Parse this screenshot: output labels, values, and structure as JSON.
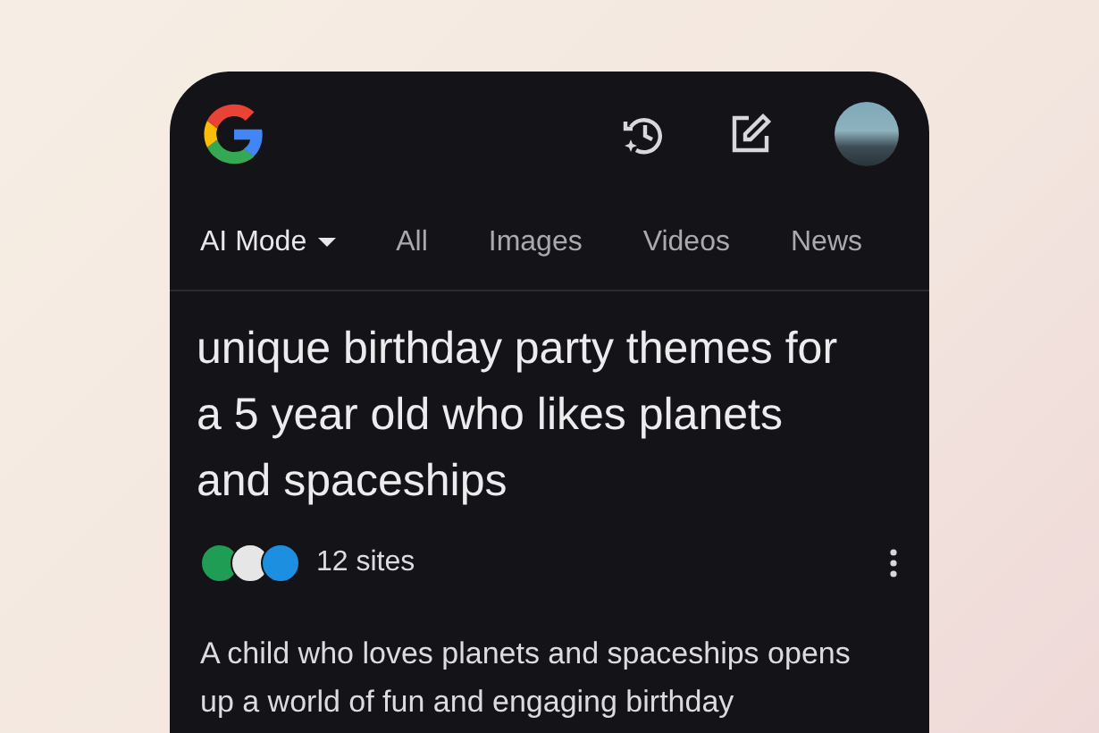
{
  "tabs": [
    {
      "label": "AI Mode",
      "selected": true,
      "dropdown": true
    },
    {
      "label": "All",
      "selected": false,
      "dropdown": false
    },
    {
      "label": "Images",
      "selected": false,
      "dropdown": false
    },
    {
      "label": "Videos",
      "selected": false,
      "dropdown": false
    },
    {
      "label": "News",
      "selected": false,
      "dropdown": false
    }
  ],
  "query": "unique birthday party themes for a 5 year old who likes planets and spaceships",
  "sources": {
    "favicons": [
      {
        "color": "#1f9d55"
      },
      {
        "color": "#e6e6e6"
      },
      {
        "color": "#1d8fe1"
      }
    ],
    "count": "12 sites"
  },
  "answer": "A child who loves planets and spaceships opens up a world of fun and engaging birthday"
}
